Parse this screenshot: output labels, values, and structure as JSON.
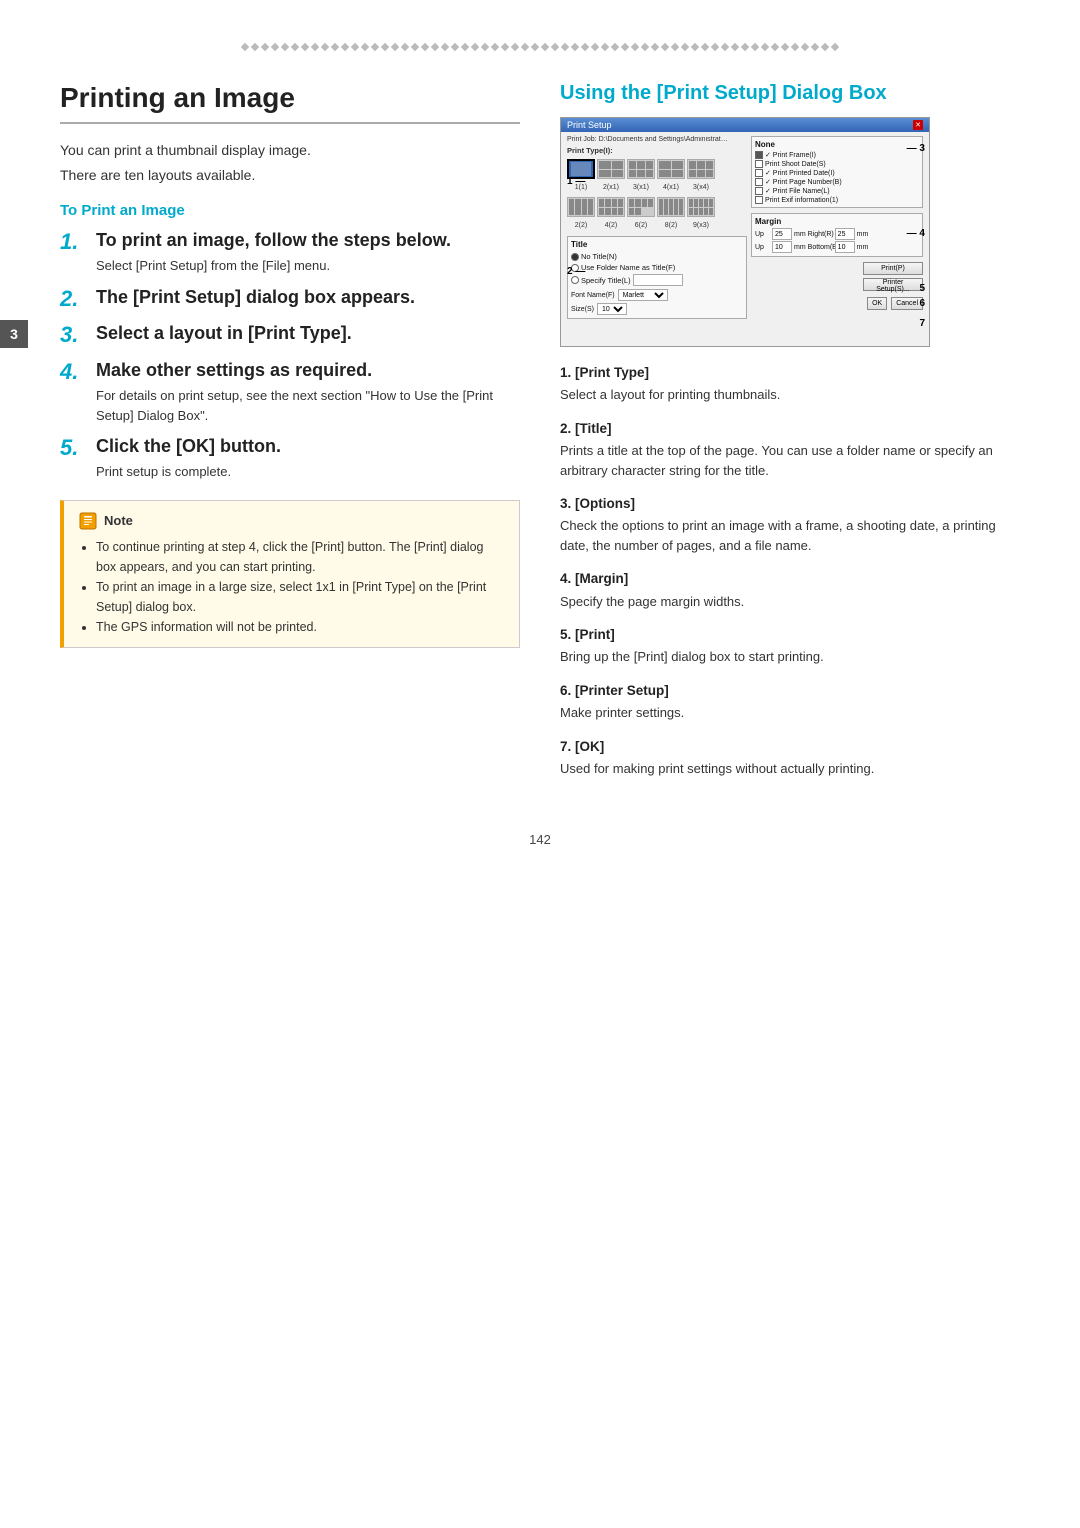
{
  "page": {
    "chapter_number": "3",
    "page_number": "142"
  },
  "deco_border": {
    "diamond_count": 60
  },
  "left": {
    "title": "Printing an Image",
    "intro_lines": [
      "You can print a thumbnail display image.",
      "There are ten layouts available."
    ],
    "section_heading": "To Print an Image",
    "steps": [
      {
        "num": "1.",
        "title": "To print an image, follow the steps below.",
        "desc": "Select [Print Setup] from the [File] menu."
      },
      {
        "num": "2.",
        "title": "The [Print Setup] dialog box appears.",
        "desc": ""
      },
      {
        "num": "3.",
        "title": "Select a layout in [Print Type].",
        "desc": ""
      },
      {
        "num": "4.",
        "title": "Make other settings as required.",
        "desc": "For details on print setup, see the next section \"How to Use the [Print Setup] Dialog Box\"."
      },
      {
        "num": "5.",
        "title": "Click the [OK] button.",
        "desc": "Print setup is complete."
      }
    ],
    "note": {
      "header": "Note",
      "items": [
        "To continue printing at step 4, click the [Print] button. The [Print] dialog box appears, and you can start printing.",
        "To print an image in a large size, select 1x1 in [Print Type] on the [Print Setup] dialog box.",
        "The GPS information will not be printed."
      ]
    }
  },
  "right": {
    "title": "Using the [Print Setup] Dialog Box",
    "dialog": {
      "title": "Print Setup",
      "path_label": "D:\\Documents and Settings\\Administrator\\My Documents\\Caplio"
    },
    "annotations": [
      {
        "num": "1",
        "label": "[Print Type]",
        "desc": "Select a layout for printing thumbnails."
      },
      {
        "num": "2",
        "label": "[Title]",
        "desc": "Prints a title at the top of the page. You can use a folder name or specify an arbitrary character string for the title."
      },
      {
        "num": "3",
        "label": "[Options]",
        "desc": "Check the options to print an image with a frame, a shooting date, a printing date, the number of pages, and a file name."
      },
      {
        "num": "4",
        "label": "[Margin]",
        "desc": "Specify the page margin widths."
      },
      {
        "num": "5",
        "label": "[Print]",
        "desc": "Bring up the [Print] dialog box to start printing."
      },
      {
        "num": "6",
        "label": "[Printer Setup]",
        "desc": "Make printer settings."
      },
      {
        "num": "7",
        "label": "[OK]",
        "desc": "Used for making print settings without actually printing."
      }
    ]
  }
}
